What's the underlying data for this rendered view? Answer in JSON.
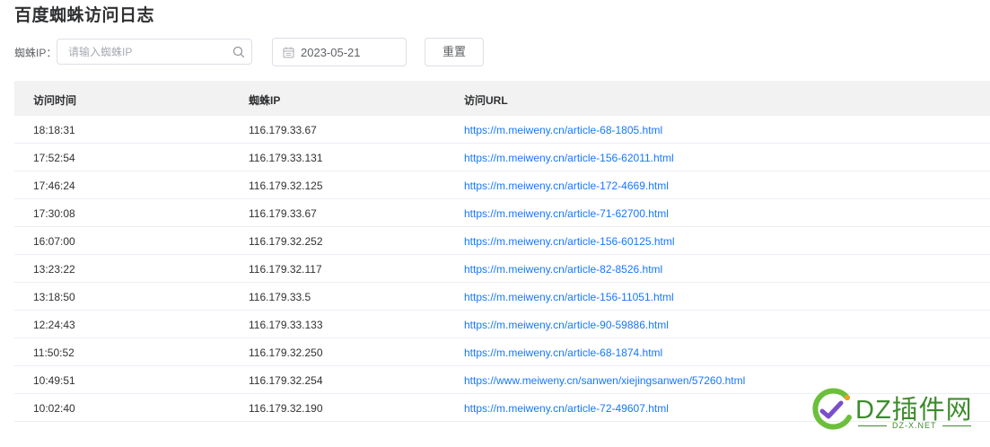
{
  "page": {
    "title": "百度蜘蛛访问日志"
  },
  "filters": {
    "ip_label": "蜘蛛IP：",
    "ip_placeholder": "请输入蜘蛛IP",
    "ip_value": "",
    "date_value": "2023-05-21",
    "reset_label": "重置"
  },
  "table": {
    "columns": [
      "访问时间",
      "蜘蛛IP",
      "访问URL"
    ],
    "rows": [
      {
        "time": "18:18:31",
        "ip": "116.179.33.67",
        "url": "https://m.meiweny.cn/article-68-1805.html"
      },
      {
        "time": "17:52:54",
        "ip": "116.179.33.131",
        "url": "https://m.meiweny.cn/article-156-62011.html"
      },
      {
        "time": "17:46:24",
        "ip": "116.179.32.125",
        "url": "https://m.meiweny.cn/article-172-4669.html"
      },
      {
        "time": "17:30:08",
        "ip": "116.179.33.67",
        "url": "https://m.meiweny.cn/article-71-62700.html"
      },
      {
        "time": "16:07:00",
        "ip": "116.179.32.252",
        "url": "https://m.meiweny.cn/article-156-60125.html"
      },
      {
        "time": "13:23:22",
        "ip": "116.179.32.117",
        "url": "https://m.meiweny.cn/article-82-8526.html"
      },
      {
        "time": "13:18:50",
        "ip": "116.179.33.5",
        "url": "https://m.meiweny.cn/article-156-11051.html"
      },
      {
        "time": "12:24:43",
        "ip": "116.179.33.133",
        "url": "https://m.meiweny.cn/article-90-59886.html"
      },
      {
        "time": "11:50:52",
        "ip": "116.179.32.250",
        "url": "https://m.meiweny.cn/article-68-1874.html"
      },
      {
        "time": "10:49:51",
        "ip": "116.179.32.254",
        "url": "https://www.meiweny.cn/sanwen/xiejingsanwen/57260.html"
      },
      {
        "time": "10:02:40",
        "ip": "116.179.32.190",
        "url": "https://m.meiweny.cn/article-72-49607.html"
      }
    ]
  },
  "watermark": {
    "text": "DZ插件网",
    "subtext": "DZ-X.NET"
  },
  "colors": {
    "link": "#1677ff",
    "header_bg": "#f2f2f2",
    "border": "#dcdfe6",
    "watermark": "#3d8c2c"
  },
  "icons": {
    "search": "search-icon",
    "calendar": "calendar-icon",
    "logo": "dz-logo-icon"
  }
}
